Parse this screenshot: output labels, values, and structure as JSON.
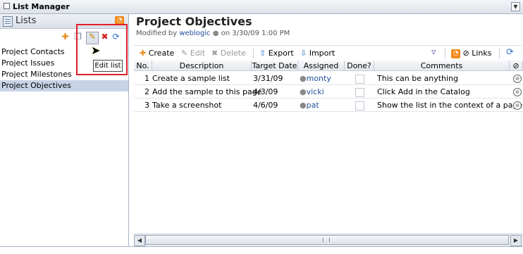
{
  "portlet": {
    "title": "List Manager"
  },
  "left_pane": {
    "title": "Lists",
    "items": [
      "Project Contacts",
      "Project Issues",
      "Project Milestones",
      "Project Objectives"
    ],
    "selected_index": 3,
    "tooltip": "Edit list"
  },
  "main": {
    "title": "Project Objectives",
    "modified_prefix": "Modified by",
    "modified_user": "weblogic",
    "modified_suffix": "on 3/30/09 1:00 PM"
  },
  "toolbar": {
    "create": "Create",
    "edit": "Edit",
    "delete": "Delete",
    "export": "Export",
    "import": "Import",
    "links": "Links"
  },
  "table": {
    "headers": [
      "No.",
      "Description",
      "Target Date",
      "Assigned",
      "Done?",
      "Comments"
    ],
    "rows": [
      {
        "no": "1",
        "description": "Create a sample list",
        "target_date": "3/31/09",
        "assigned": "monty",
        "comments": "This can be anything"
      },
      {
        "no": "2",
        "description": "Add the sample to this page",
        "target_date": "4/3/09",
        "assigned": "vicki",
        "comments": "Click Add in the Catalog"
      },
      {
        "no": "3",
        "description": "Take a screenshot",
        "target_date": "4/6/09",
        "assigned": "pat",
        "comments": "Show the list in the context of a page"
      }
    ]
  },
  "colors": {
    "highlight_box": "#e0202a",
    "selected_row": "#c9d3e6",
    "link": "#1f4e9a",
    "rss": "#f28a1a"
  }
}
